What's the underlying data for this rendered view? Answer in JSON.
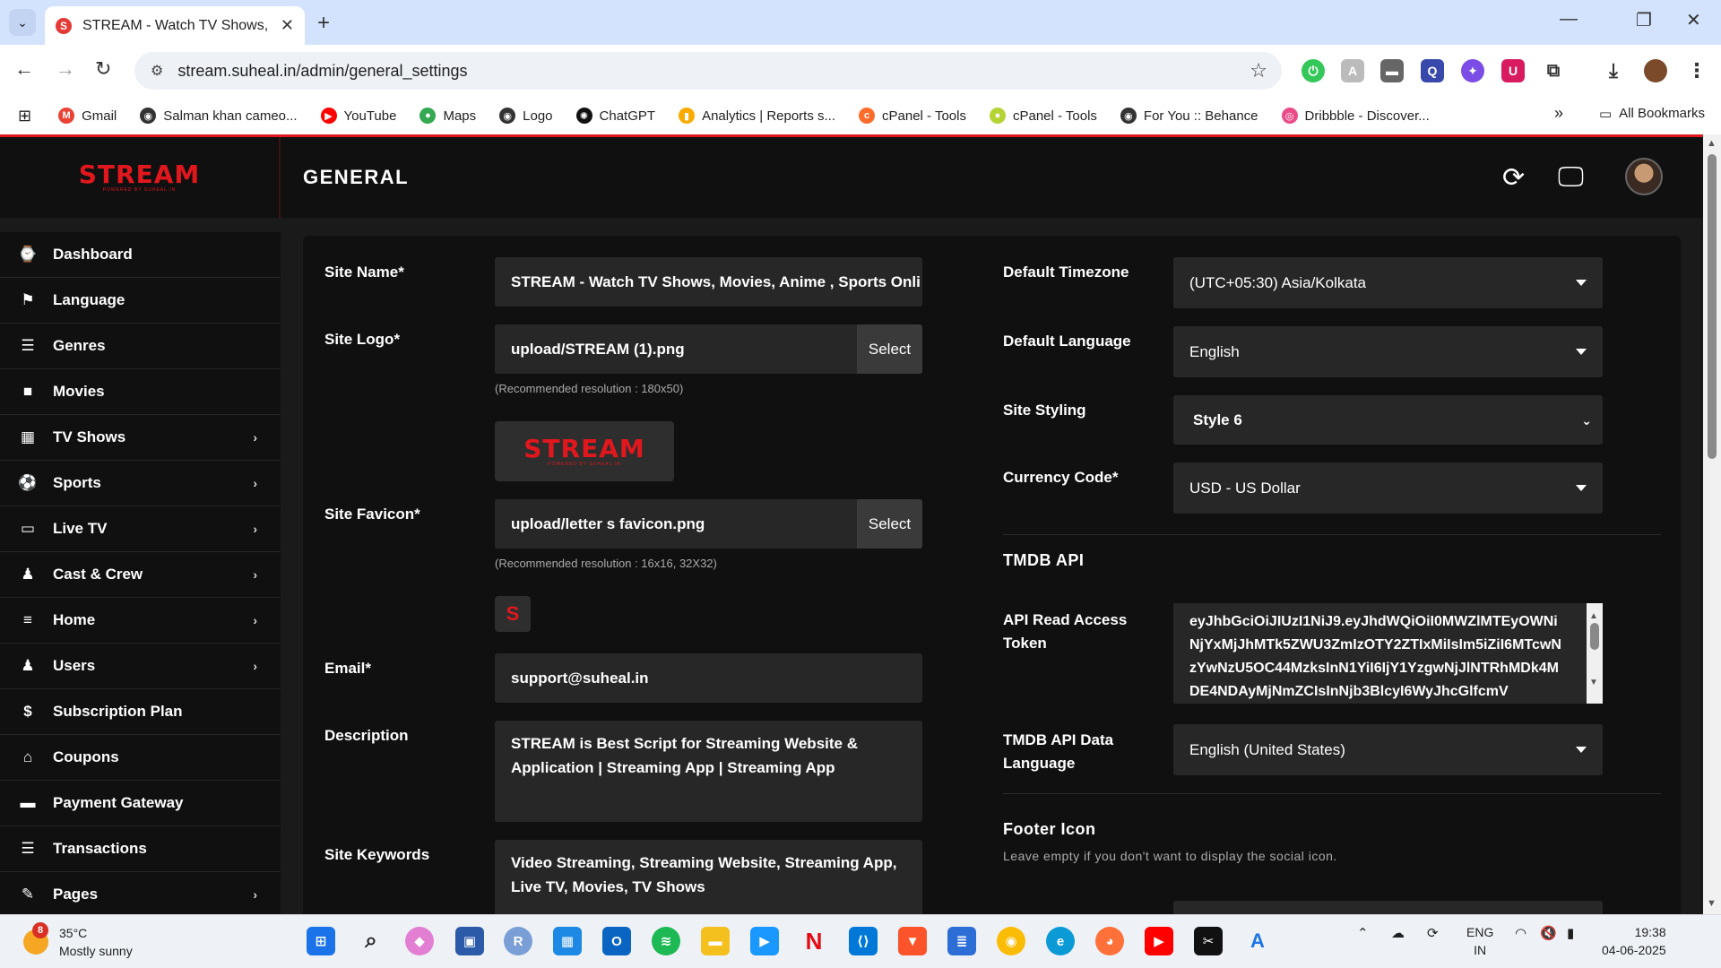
{
  "browser": {
    "tab_title": "STREAM - Watch TV Shows, Mo",
    "favicon_letter": "S",
    "url": "stream.suheal.in/admin/general_settings",
    "bookmarks": [
      {
        "label": "Gmail",
        "color": "#ea4335",
        "glyph": "M"
      },
      {
        "label": "Salman khan cameo...",
        "color": "#333333",
        "glyph": "◉"
      },
      {
        "label": "YouTube",
        "color": "#ff0000",
        "glyph": "▶"
      },
      {
        "label": "Maps",
        "color": "#34a853",
        "glyph": "●"
      },
      {
        "label": "Logo",
        "color": "#333333",
        "glyph": "◉"
      },
      {
        "label": "ChatGPT",
        "color": "#111111",
        "glyph": "✺"
      },
      {
        "label": "Analytics | Reports s...",
        "color": "#f9ab00",
        "glyph": "▮"
      },
      {
        "label": "cPanel - Tools",
        "color": "#ff6c2c",
        "glyph": "c"
      },
      {
        "label": "cPanel - Tools",
        "color": "#b5d334",
        "glyph": "●"
      },
      {
        "label": "For You :: Behance",
        "color": "#333333",
        "glyph": "◉"
      },
      {
        "label": "Dribbble - Discover...",
        "color": "#ea4c89",
        "glyph": "◎"
      }
    ],
    "all_bookmarks": "All Bookmarks"
  },
  "header": {
    "logo_text": "STREAM",
    "logo_sub": "POWERED BY SUHEAL.IN",
    "page_title": "GENERAL"
  },
  "sidebar": {
    "items": [
      {
        "label": "Dashboard",
        "icon": "⌚",
        "chevron": false
      },
      {
        "label": "Language",
        "icon": "⚑",
        "chevron": false
      },
      {
        "label": "Genres",
        "icon": "☰",
        "chevron": false
      },
      {
        "label": "Movies",
        "icon": "■",
        "chevron": false
      },
      {
        "label": "TV Shows",
        "icon": "▦",
        "chevron": true
      },
      {
        "label": "Sports",
        "icon": "⚽",
        "chevron": true
      },
      {
        "label": "Live TV",
        "icon": "▭",
        "chevron": true
      },
      {
        "label": "Cast & Crew",
        "icon": "♟",
        "chevron": true
      },
      {
        "label": "Home",
        "icon": "≡",
        "chevron": true
      },
      {
        "label": "Users",
        "icon": "♟",
        "chevron": true
      },
      {
        "label": "Subscription Plan",
        "icon": "$",
        "chevron": false
      },
      {
        "label": "Coupons",
        "icon": "⌂",
        "chevron": false
      },
      {
        "label": "Payment Gateway",
        "icon": "▬",
        "chevron": false
      },
      {
        "label": "Transactions",
        "icon": "☰",
        "chevron": false
      },
      {
        "label": "Pages",
        "icon": "✎",
        "chevron": true
      }
    ]
  },
  "form_left": {
    "site_name_label": "Site Name*",
    "site_name_value": "STREAM  - Watch TV Shows, Movies, Anime , Sports Onli",
    "site_logo_label": "Site Logo*",
    "site_logo_value": "upload/STREAM (1).png",
    "select_label": "Select",
    "logo_hint": "(Recommended resolution : 180x50)",
    "site_favicon_label": "Site Favicon*",
    "site_favicon_value": "upload/letter s favicon.png",
    "favicon_hint": "(Recommended resolution : 16x16, 32X32)",
    "email_label": "Email*",
    "email_value": "support@suheal.in",
    "description_label": "Description",
    "description_value": "STREAM is Best Script for Streaming Website & Application | Streaming App  | Streaming App",
    "keywords_label": "Site Keywords",
    "keywords_value": "Video Streaming, Streaming Website, Streaming App, Live TV, Movies, TV Shows"
  },
  "form_right": {
    "timezone_label": "Default Timezone",
    "timezone_value": "(UTC+05:30) Asia/Kolkata",
    "language_label": "Default Language",
    "language_value": "English",
    "styling_label": "Site Styling",
    "styling_value": "Style 6",
    "currency_label": "Currency Code*",
    "currency_value": "USD - US Dollar",
    "tmdb_title": "TMDB API",
    "token_label": "API Read Access Token",
    "token_value": "eyJhbGciOiJIUzI1NiJ9.eyJhdWQiOiI0MWZlMTEyOWNiNjYxMjJhMTk5ZWU3ZmIzOTY2ZTIxMiIsIm5iZiI6MTcwNzYwNzU5OC44MzksInN1YiI6IjY1YzgwNjJlNTRhMDk4MDE4NDAyMjNmZCIsInNjb3BlcyI6WyJhcGlfcmV",
    "tmdb_lang_label": "TMDB API Data Language",
    "tmdb_lang_value": "English (United States)",
    "footer_icon_title": "Footer Icon",
    "footer_icon_hint": "Leave empty if you don't want to display the social icon."
  },
  "taskbar": {
    "temp": "35°C",
    "condition": "Mostly sunny",
    "weather_badge": "8",
    "lang_top": "ENG",
    "lang_bottom": "IN",
    "time": "19:38",
    "date": "04-06-2025"
  },
  "colors": {
    "accent": "#e1171e",
    "panel": "#101010",
    "field": "#272727"
  }
}
